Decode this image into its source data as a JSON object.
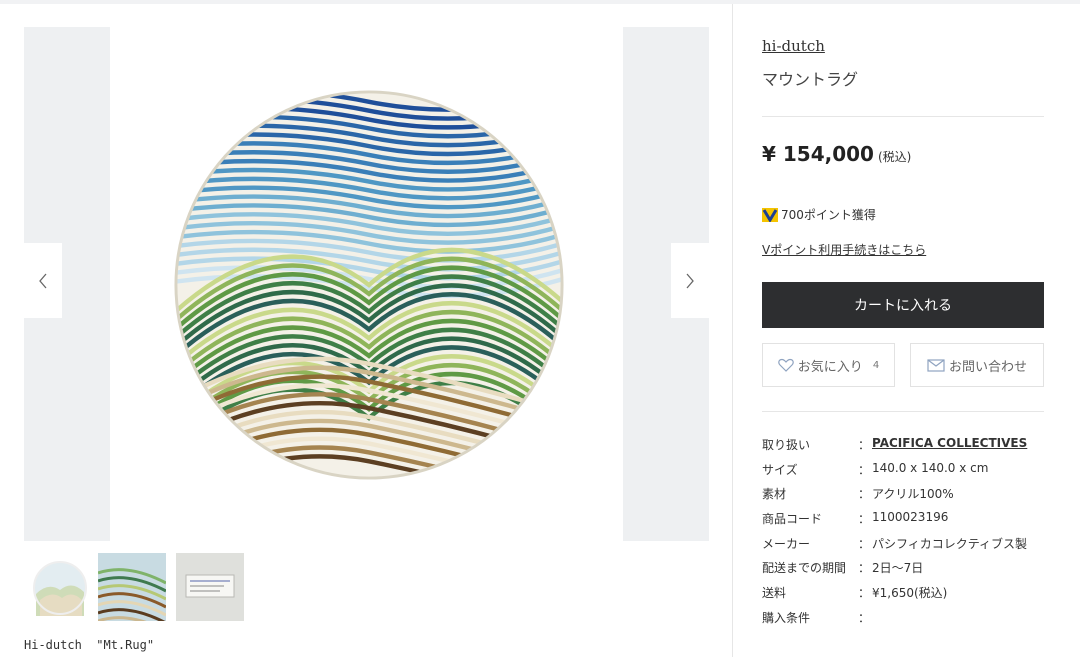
{
  "product": {
    "brand": "hi-dutch",
    "title": "マウントラグ",
    "price": "¥ 154,000",
    "tax_note": "(税込)",
    "points": "700ポイント獲得",
    "points_link": "Vポイント利用手続きはこちら"
  },
  "actions": {
    "cart_label": "カートに入れる",
    "favorite_label": "お気に入り",
    "favorite_count": "4",
    "contact_label": "お問い合わせ"
  },
  "gallery": {
    "caption": "Hi-dutch  \"Mt.Rug\""
  },
  "specs": [
    {
      "key": "取り扱い",
      "value": "PACIFICA COLLECTIVES"
    },
    {
      "key": "サイズ",
      "value": "140.0 x 140.0 x cm"
    },
    {
      "key": "素材",
      "value": "アクリル100%"
    },
    {
      "key": "商品コード",
      "value": "1100023196"
    },
    {
      "key": "メーカー",
      "value": "パシフィカコレクティブス製"
    },
    {
      "key": "配送までの期間",
      "value": "2日〜7日"
    },
    {
      "key": "送料",
      "value": "¥1,650(税込)"
    },
    {
      "key": "購入条件",
      "value": ""
    }
  ],
  "spec_separator": "：",
  "icons": {
    "prev": "chevron-left-icon",
    "next": "chevron-right-icon",
    "favorite": "heart-icon",
    "contact": "mail-icon",
    "points": "v-point-icon"
  },
  "colors": {
    "cart_button": "#2d2e30",
    "point_icon_yellow": "#f5c400",
    "point_icon_blue": "#1c3f94"
  }
}
